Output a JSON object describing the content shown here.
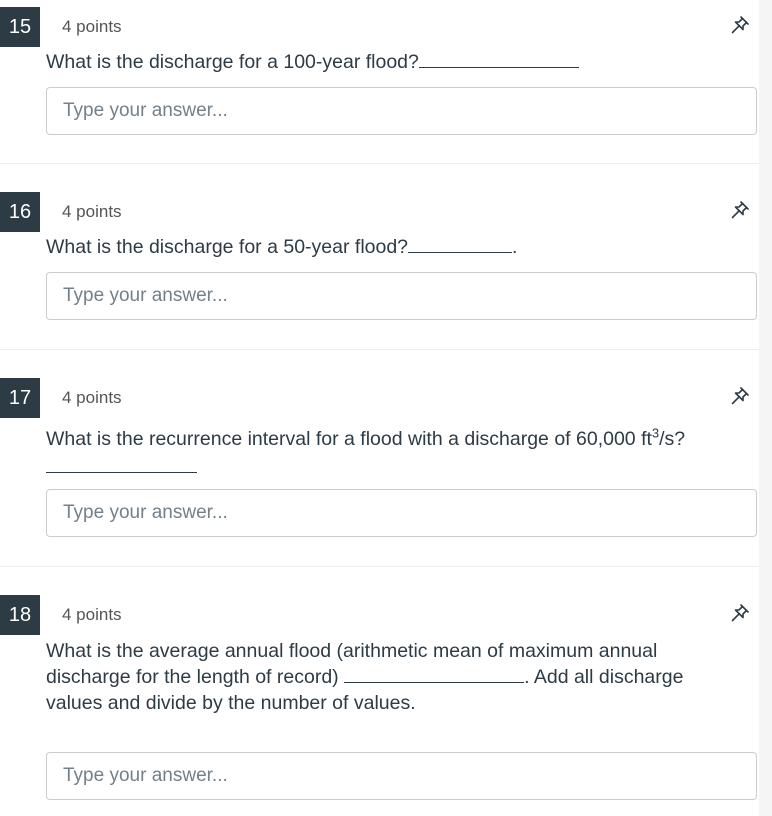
{
  "questions": [
    {
      "number": "15",
      "points": "4 points",
      "text": "What is the discharge for a 100-year flood?",
      "answer_placeholder": "Type your answer...",
      "answer_value": ""
    },
    {
      "number": "16",
      "points": "4 points",
      "text": "What is the discharge for a 50-year flood?",
      "text_after_blank": ".",
      "answer_placeholder": "Type your answer...",
      "answer_value": ""
    },
    {
      "number": "17",
      "points": "4 points",
      "text_before_sup": "What is the recurrence interval for a flood with a discharge of 60,000 ft",
      "sup": "3",
      "text_after_sup": "/s?",
      "answer_placeholder": "Type your answer...",
      "answer_value": ""
    },
    {
      "number": "18",
      "points": "4 points",
      "text_line1": "What is the average annual flood (arithmetic mean of maximum annual",
      "text_line2": "discharge for the length of record)",
      "text_line2_after": ". Add all discharge",
      "text_line3": "values and divide by the number of values.",
      "answer_placeholder": "Type your answer...",
      "answer_value": ""
    }
  ],
  "icons": {
    "pin": "pin-icon"
  },
  "colors": {
    "number_badge_bg": "#2d3b45",
    "text": "#2d3b45",
    "input_border": "#c7cdd1"
  }
}
